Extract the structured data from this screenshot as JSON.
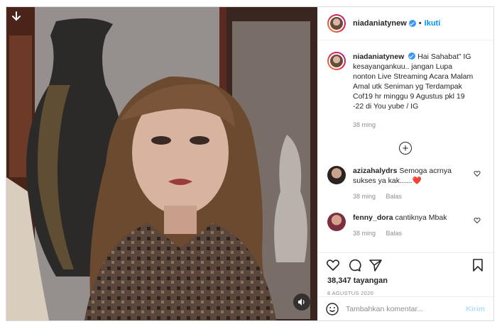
{
  "post": {
    "username": "niadaniatynew",
    "follow_label": "Ikuti",
    "separator": "•",
    "caption": "Hai Sahabat” IG kesayangankuu.. jangan Lupa nonton Live Streaming Acara Malam Amal utk Seniman yg Terdampak Cof19 hr minggu 9 Agustus pkl 19 -22 di You yube / IG",
    "caption_time": "38 ming",
    "load_more_symbol": "+",
    "reply_label": "Balas"
  },
  "comments": [
    {
      "username": "azizahalydrs",
      "text": "Semoga acrnya sukses ya kak......",
      "emoji": "❤️",
      "time": "38 ming",
      "reply": "Balas"
    },
    {
      "username": "fenny_dora",
      "text": "cantiknya Mbak",
      "emoji": "",
      "time": "38 ming",
      "reply": "Balas"
    }
  ],
  "stats": {
    "views": "38,347 tayangan",
    "date": "8 AGUSTUS 2020"
  },
  "composer": {
    "placeholder": "Tambahkan komentar...",
    "post_label": "Kirim"
  },
  "colors": {
    "accent": "#0095f6",
    "verified": "#3897f0",
    "muted": "#8e8e8e",
    "heart": "#ed4956"
  },
  "icons": [
    "download-icon",
    "sound-icon",
    "verified-icon",
    "load-more-icon",
    "heart-icon",
    "comment-icon",
    "share-icon",
    "save-icon",
    "emoji-icon"
  ]
}
